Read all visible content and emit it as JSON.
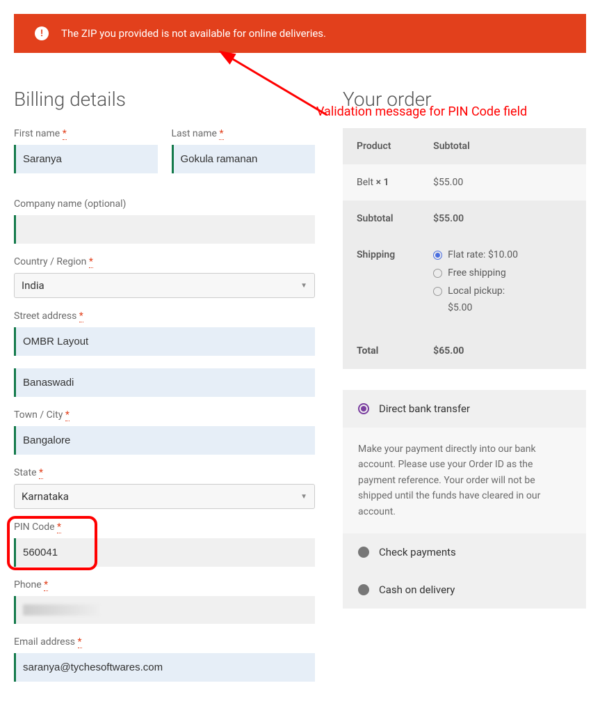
{
  "error": {
    "message": "The ZIP you provided is not available for online deliveries."
  },
  "annotation": {
    "text": "Validation message for PIN Code field"
  },
  "billing": {
    "heading": "Billing details",
    "first_name": {
      "label": "First name",
      "value": "Saranya",
      "required": true
    },
    "last_name": {
      "label": "Last name",
      "value": "Gokula ramanan",
      "required": true
    },
    "company": {
      "label": "Company name (optional)",
      "value": ""
    },
    "country": {
      "label": "Country / Region",
      "value": "India",
      "required": true
    },
    "address1": {
      "label": "Street address",
      "value": "OMBR Layout",
      "required": true
    },
    "address2": {
      "value": "Banaswadi"
    },
    "city": {
      "label": "Town / City",
      "value": "Bangalore",
      "required": true
    },
    "state": {
      "label": "State",
      "value": "Karnataka",
      "required": true
    },
    "pin": {
      "label": "PIN Code",
      "value": "560041",
      "required": true
    },
    "phone": {
      "label": "Phone",
      "value": "",
      "required": true
    },
    "email": {
      "label": "Email address",
      "value": "saranya@tychesoftwares.com",
      "required": true
    }
  },
  "order": {
    "heading": "Your order",
    "columns": {
      "product": "Product",
      "subtotal": "Subtotal"
    },
    "items": [
      {
        "name": "Belt",
        "qty": "× 1",
        "amount": "$55.00"
      }
    ],
    "subtotal": {
      "label": "Subtotal",
      "amount": "$55.00"
    },
    "shipping": {
      "label": "Shipping",
      "options": [
        {
          "label": "Flat rate:",
          "amount": "$10.00",
          "selected": true
        },
        {
          "label": "Free shipping",
          "amount": "",
          "selected": false
        },
        {
          "label": "Local pickup:",
          "amount": "$5.00",
          "selected": false
        }
      ]
    },
    "total": {
      "label": "Total",
      "amount": "$65.00"
    },
    "payments": [
      {
        "label": "Direct bank transfer",
        "selected": true,
        "desc": "Make your payment directly into our bank account. Please use your Order ID as the payment reference. Your order will not be shipped until the funds have cleared in our account."
      },
      {
        "label": "Check payments",
        "selected": false
      },
      {
        "label": "Cash on delivery",
        "selected": false
      }
    ]
  }
}
